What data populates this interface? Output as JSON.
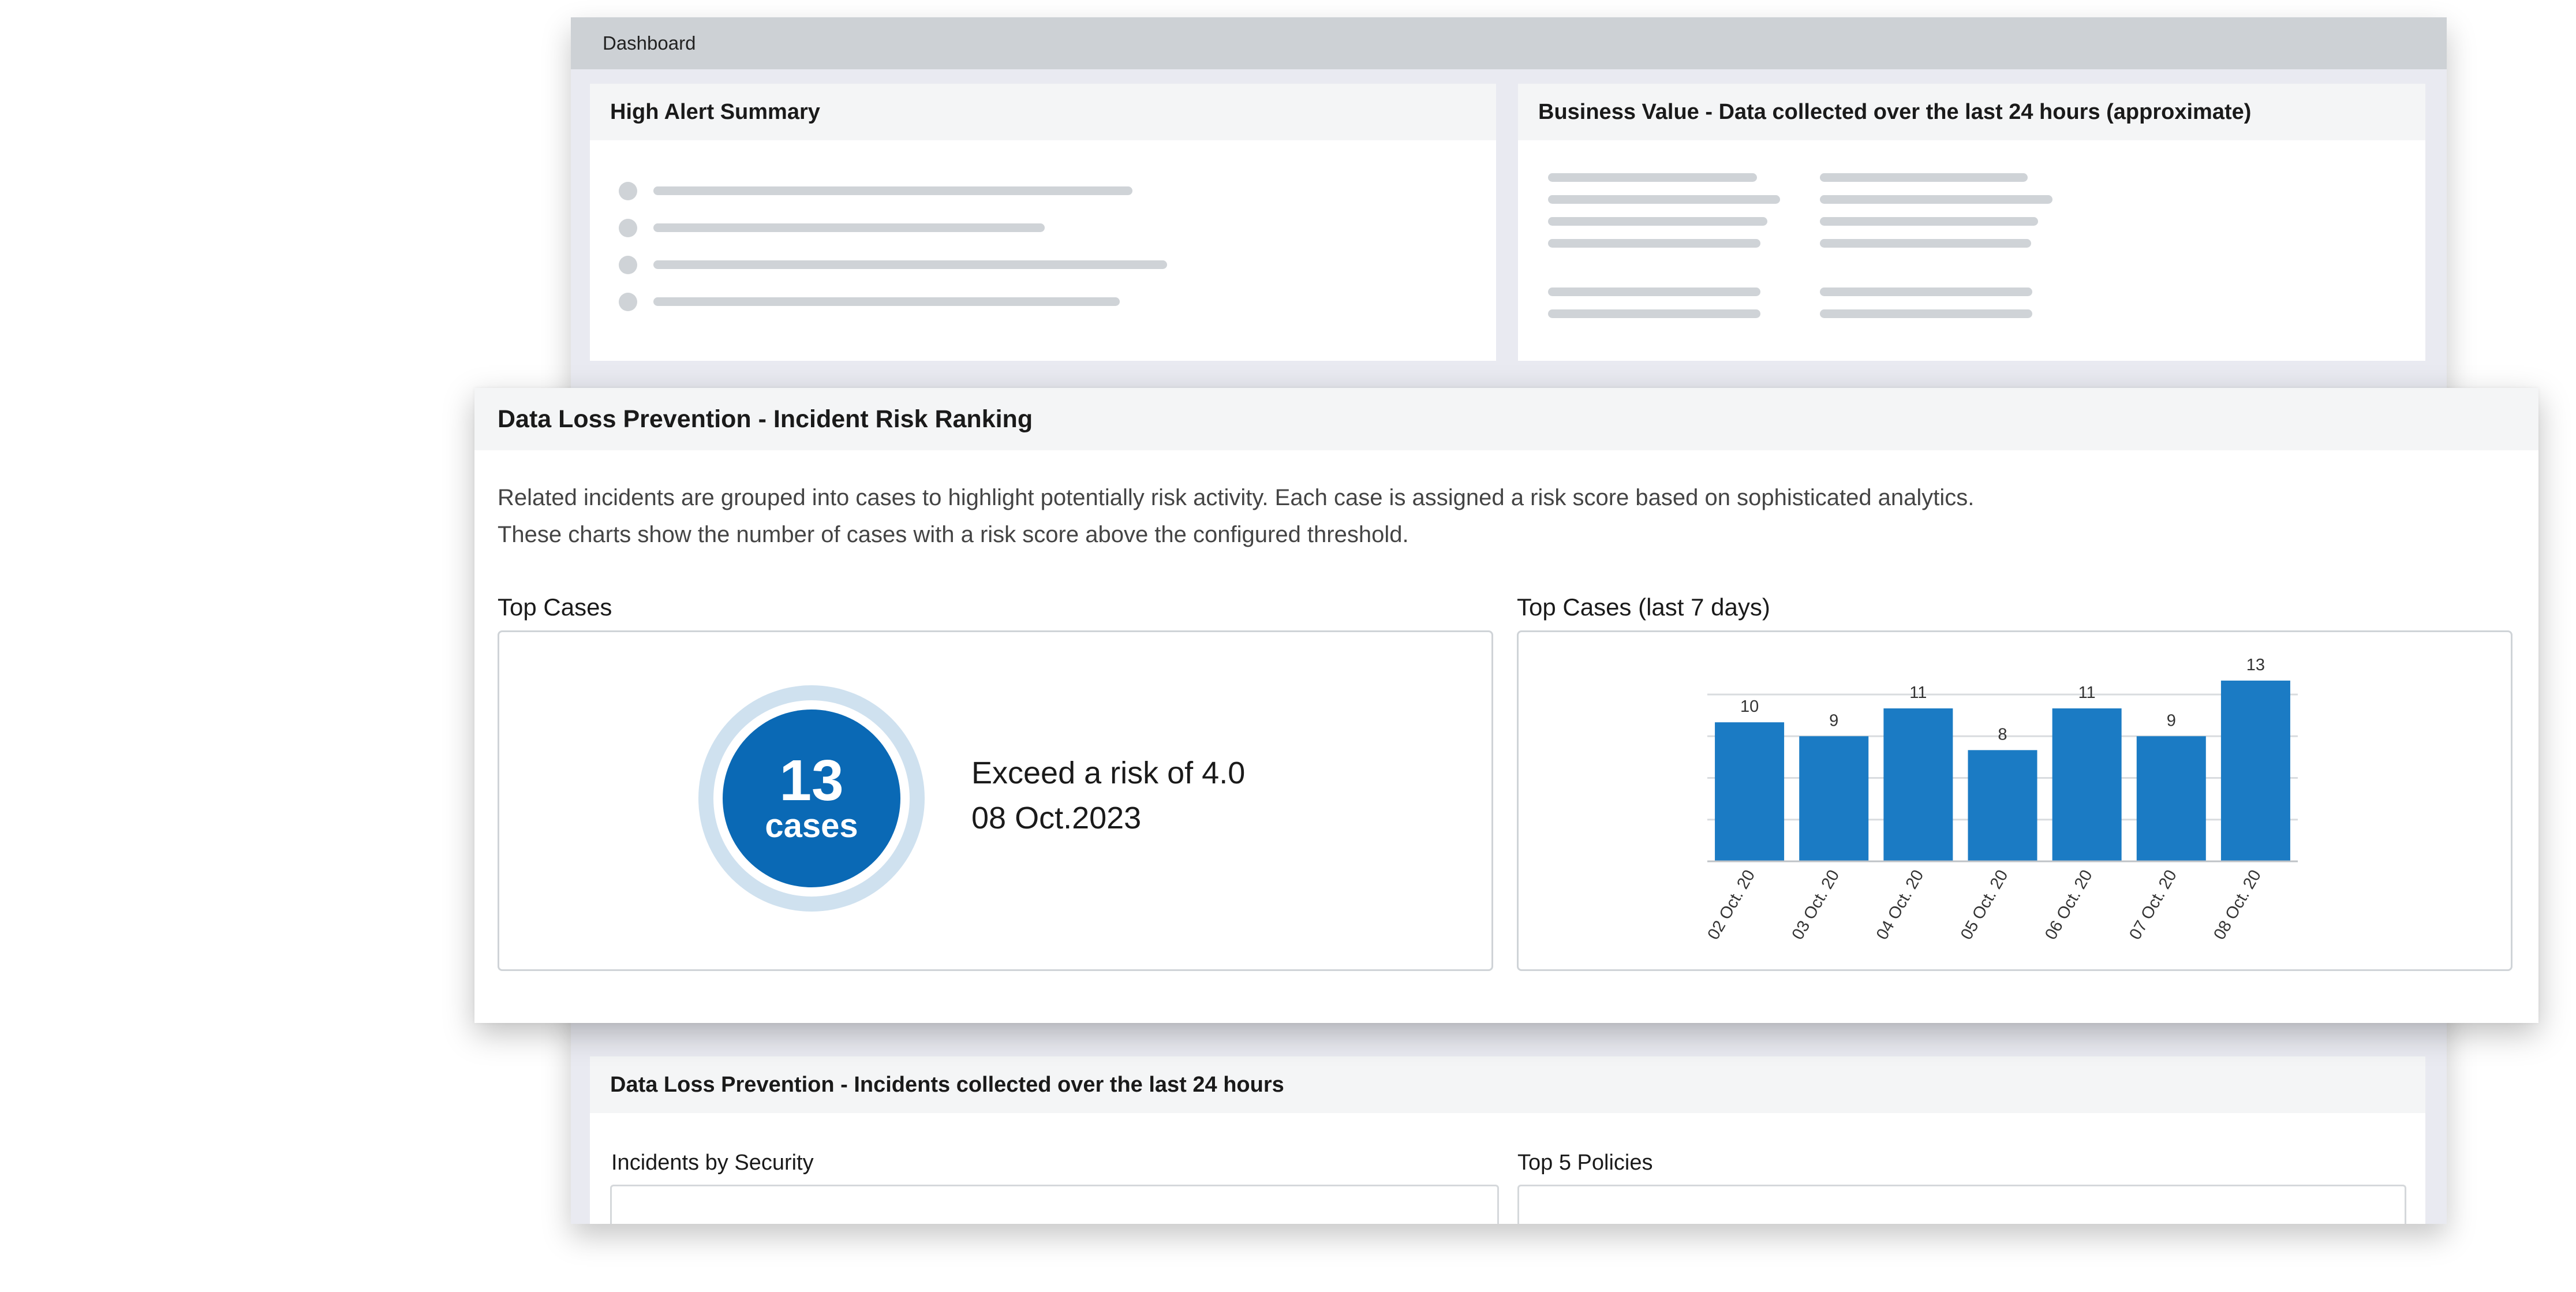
{
  "window": {
    "title": "Dashboard"
  },
  "high_alert": {
    "title": "High Alert Summary"
  },
  "business_value": {
    "title": "Business Value - Data collected over the last 24 hours (approximate)"
  },
  "incidents_24h": {
    "title": "Data Loss Prevention - Incidents collected over the last 24 hours",
    "incidents_by_security_label": "Incidents by Security",
    "top_policies_label": "Top 5 Policies"
  },
  "risk_panel": {
    "title": "Data Loss Prevention - Incident Risk Ranking",
    "description_line1": "Related incidents are grouped into cases to highlight potentially risk activity. Each case is assigned a risk score based on sophisticated analytics.",
    "description_line2": "These charts show the number of cases with a risk score above the configured threshold.",
    "top_cases": {
      "label": "Top Cases",
      "count": "13",
      "unit": "cases",
      "risk_line": "Exceed a risk of 4.0",
      "date_line": "08 Oct.2023"
    },
    "top_cases_7d": {
      "label": "Top Cases (last 7 days)"
    }
  },
  "colors": {
    "accent": "#0a69b5",
    "bar": "#1b7bc4",
    "ring_light": "#cfe1ef",
    "skeleton": "#cfd3d7"
  },
  "chart_data": {
    "type": "bar",
    "categories": [
      "02 Oct. 20",
      "03 Oct. 20",
      "04 Oct. 20",
      "05 Oct. 20",
      "06 Oct. 20",
      "07 Oct. 20",
      "08 Oct. 20"
    ],
    "values": [
      10,
      9,
      11,
      8,
      11,
      9,
      13
    ],
    "title": "Top Cases (last 7 days)",
    "xlabel": "",
    "ylabel": "",
    "ylim": [
      0,
      12
    ],
    "grid": true,
    "data_labels": true
  }
}
